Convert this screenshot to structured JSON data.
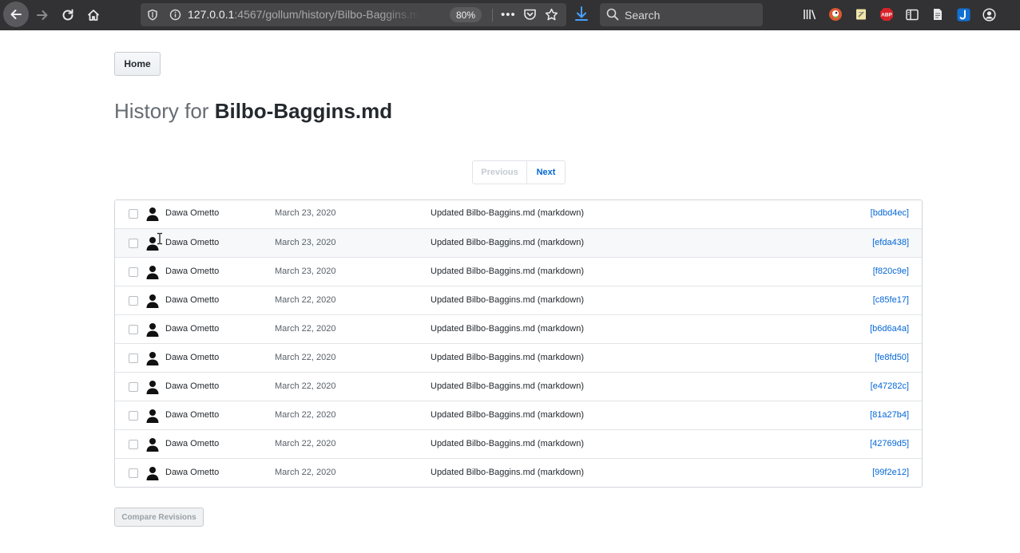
{
  "browser": {
    "url_host": "127.0.0.1",
    "url_rest": ":4567/gollum/history/Bilbo-Baggins.m",
    "zoom": "80%",
    "search_placeholder": "Search",
    "more_label": "•••"
  },
  "page": {
    "home_label": "Home",
    "title_prefix": "History for ",
    "title_file": "Bilbo-Baggins.md",
    "pager": {
      "previous": "Previous",
      "next": "Next"
    },
    "compare_label": "Compare Revisions"
  },
  "commits": [
    {
      "author": "Dawa Ometto",
      "date": "March 23, 2020",
      "message": "Updated Bilbo-Baggins.md (markdown)",
      "sha": "[bdbd4ec]"
    },
    {
      "author": "Dawa Ometto",
      "date": "March 23, 2020",
      "message": "Updated Bilbo-Baggins.md (markdown)",
      "sha": "[efda438]"
    },
    {
      "author": "Dawa Ometto",
      "date": "March 23, 2020",
      "message": "Updated Bilbo-Baggins.md (markdown)",
      "sha": "[f820c9e]"
    },
    {
      "author": "Dawa Ometto",
      "date": "March 22, 2020",
      "message": "Updated Bilbo-Baggins.md (markdown)",
      "sha": "[c85fe17]"
    },
    {
      "author": "Dawa Ometto",
      "date": "March 22, 2020",
      "message": "Updated Bilbo-Baggins.md (markdown)",
      "sha": "[b6d6a4a]"
    },
    {
      "author": "Dawa Ometto",
      "date": "March 22, 2020",
      "message": "Updated Bilbo-Baggins.md (markdown)",
      "sha": "[fe8fd50]"
    },
    {
      "author": "Dawa Ometto",
      "date": "March 22, 2020",
      "message": "Updated Bilbo-Baggins.md (markdown)",
      "sha": "[e47282c]"
    },
    {
      "author": "Dawa Ometto",
      "date": "March 22, 2020",
      "message": "Updated Bilbo-Baggins.md (markdown)",
      "sha": "[81a27b4]"
    },
    {
      "author": "Dawa Ometto",
      "date": "March 22, 2020",
      "message": "Updated Bilbo-Baggins.md (markdown)",
      "sha": "[42769d5]"
    },
    {
      "author": "Dawa Ometto",
      "date": "March 22, 2020",
      "message": "Updated Bilbo-Baggins.md (markdown)",
      "sha": "[99f2e12]"
    }
  ],
  "colors": {
    "toolbar_bg": "#323234",
    "link": "#0366d6",
    "row_alt": "#f6f8fa"
  }
}
